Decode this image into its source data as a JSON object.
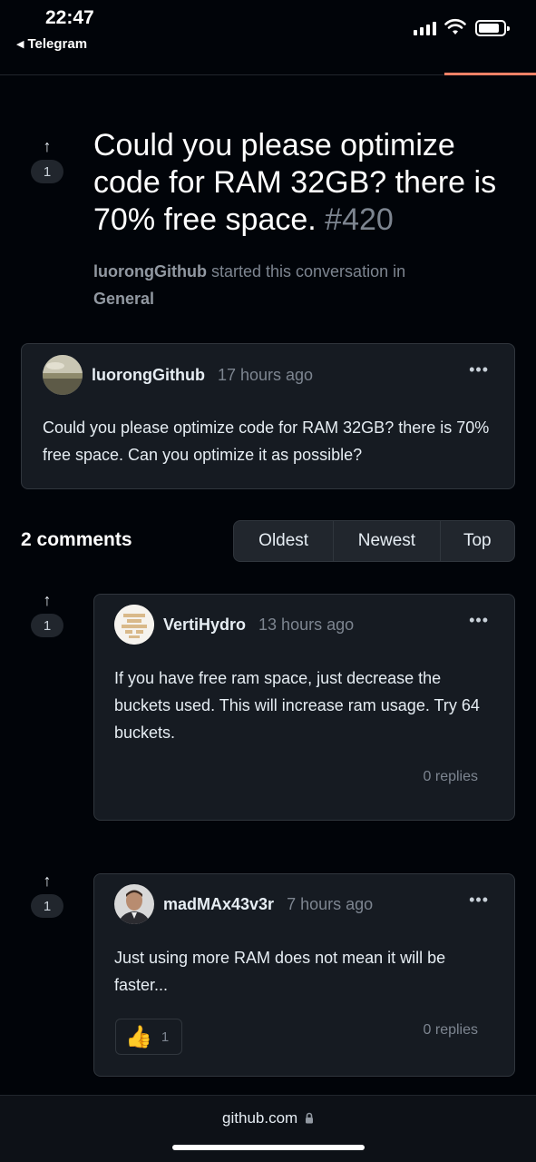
{
  "status_bar": {
    "time": "22:47",
    "back_app": "Telegram"
  },
  "discussion": {
    "votes": "1",
    "title": "Could you please optimize code for RAM 32GB? there is 70% free space.",
    "number": "#420",
    "author": "luorongGithub",
    "started_text": "started this conversation in",
    "category": "General"
  },
  "original_post": {
    "author": "luorongGithub",
    "time": "17 hours ago",
    "body": "Could you please optimize code for RAM 32GB? there is 70% free space. Can you optimize it as possible?",
    "menu": "•••"
  },
  "comments_header": {
    "count_label": "2 comments",
    "sort_options": [
      "Oldest",
      "Newest",
      "Top"
    ]
  },
  "comments": [
    {
      "votes": "1",
      "author": "VertiHydro",
      "time": "13 hours ago",
      "body": "If you have free ram space, just decrease the buckets used. This will increase ram usage. Try 64 buckets.",
      "replies": "0 replies",
      "menu": "•••"
    },
    {
      "votes": "1",
      "author": "madMAx43v3r",
      "time": "7 hours ago",
      "body": "Just using more RAM does not mean it will be faster...",
      "reaction_emoji": "👍",
      "reaction_count": "1",
      "replies": "0 replies",
      "menu": "•••"
    }
  ],
  "browser": {
    "url": "github.com"
  },
  "colors": {
    "background": "#010409",
    "card": "#161b22",
    "border": "#30363d",
    "muted": "#7d8590",
    "accent_progress": "#f78166"
  }
}
